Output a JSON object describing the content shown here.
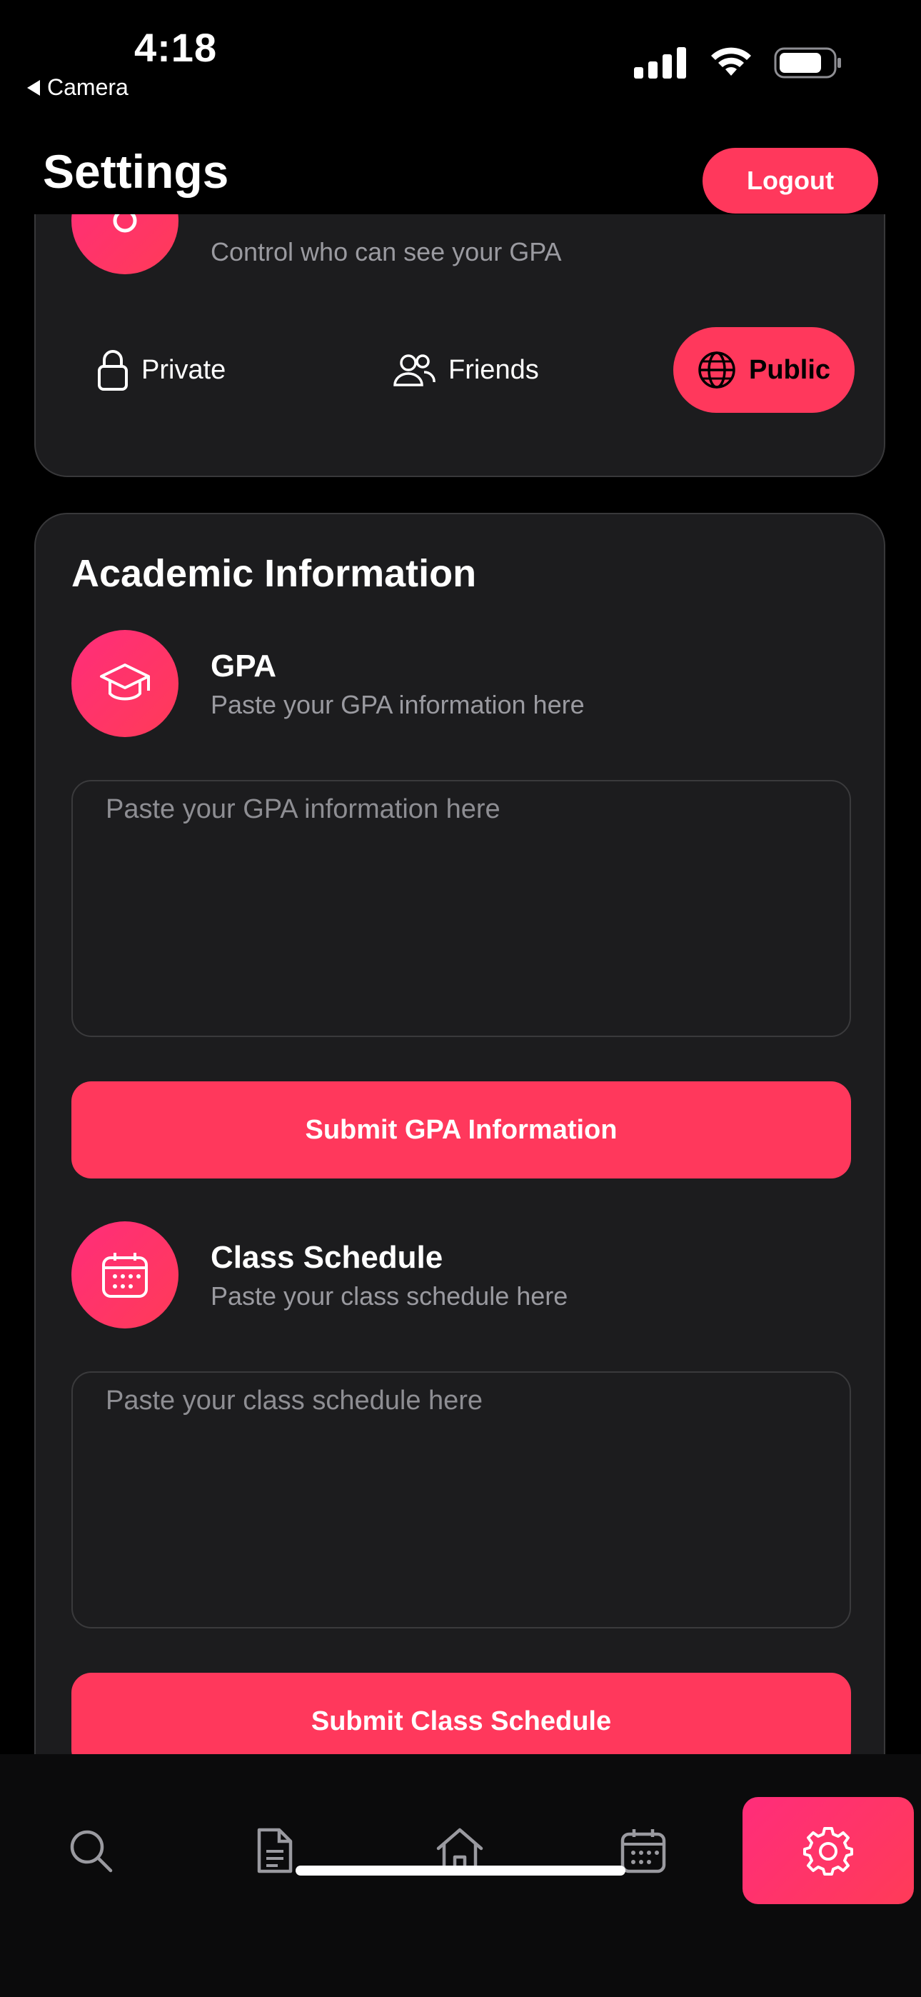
{
  "status_bar": {
    "time": "4:18",
    "back_label": "Camera"
  },
  "header": {
    "title": "Settings",
    "logout_label": "Logout"
  },
  "visibility": {
    "description": "Control who can see your GPA",
    "options": [
      {
        "label": "Private",
        "icon": "lock-icon",
        "active": false
      },
      {
        "label": "Friends",
        "icon": "people-icon",
        "active": false
      },
      {
        "label": "Public",
        "icon": "globe-icon",
        "active": true
      }
    ]
  },
  "academic": {
    "title": "Academic Information",
    "gpa": {
      "title": "GPA",
      "description": "Paste your GPA information here",
      "placeholder": "Paste your GPA information here",
      "submit_label": "Submit GPA Information",
      "icon": "graduation-cap-icon"
    },
    "schedule": {
      "title": "Class Schedule",
      "description": "Paste your class schedule here",
      "placeholder": "Paste your class schedule here",
      "submit_label": "Submit Class Schedule",
      "icon": "calendar-icon"
    }
  },
  "tabbar": {
    "items": [
      {
        "icon": "search-icon",
        "active": false
      },
      {
        "icon": "document-icon",
        "active": false
      },
      {
        "icon": "home-icon",
        "active": false
      },
      {
        "icon": "calendar-icon",
        "active": false
      },
      {
        "icon": "gear-icon",
        "active": true
      }
    ]
  },
  "colors": {
    "accent": "#ff385c",
    "gradient_start": "#ff2d7a",
    "card": "#1c1c1e",
    "background": "#000000"
  }
}
